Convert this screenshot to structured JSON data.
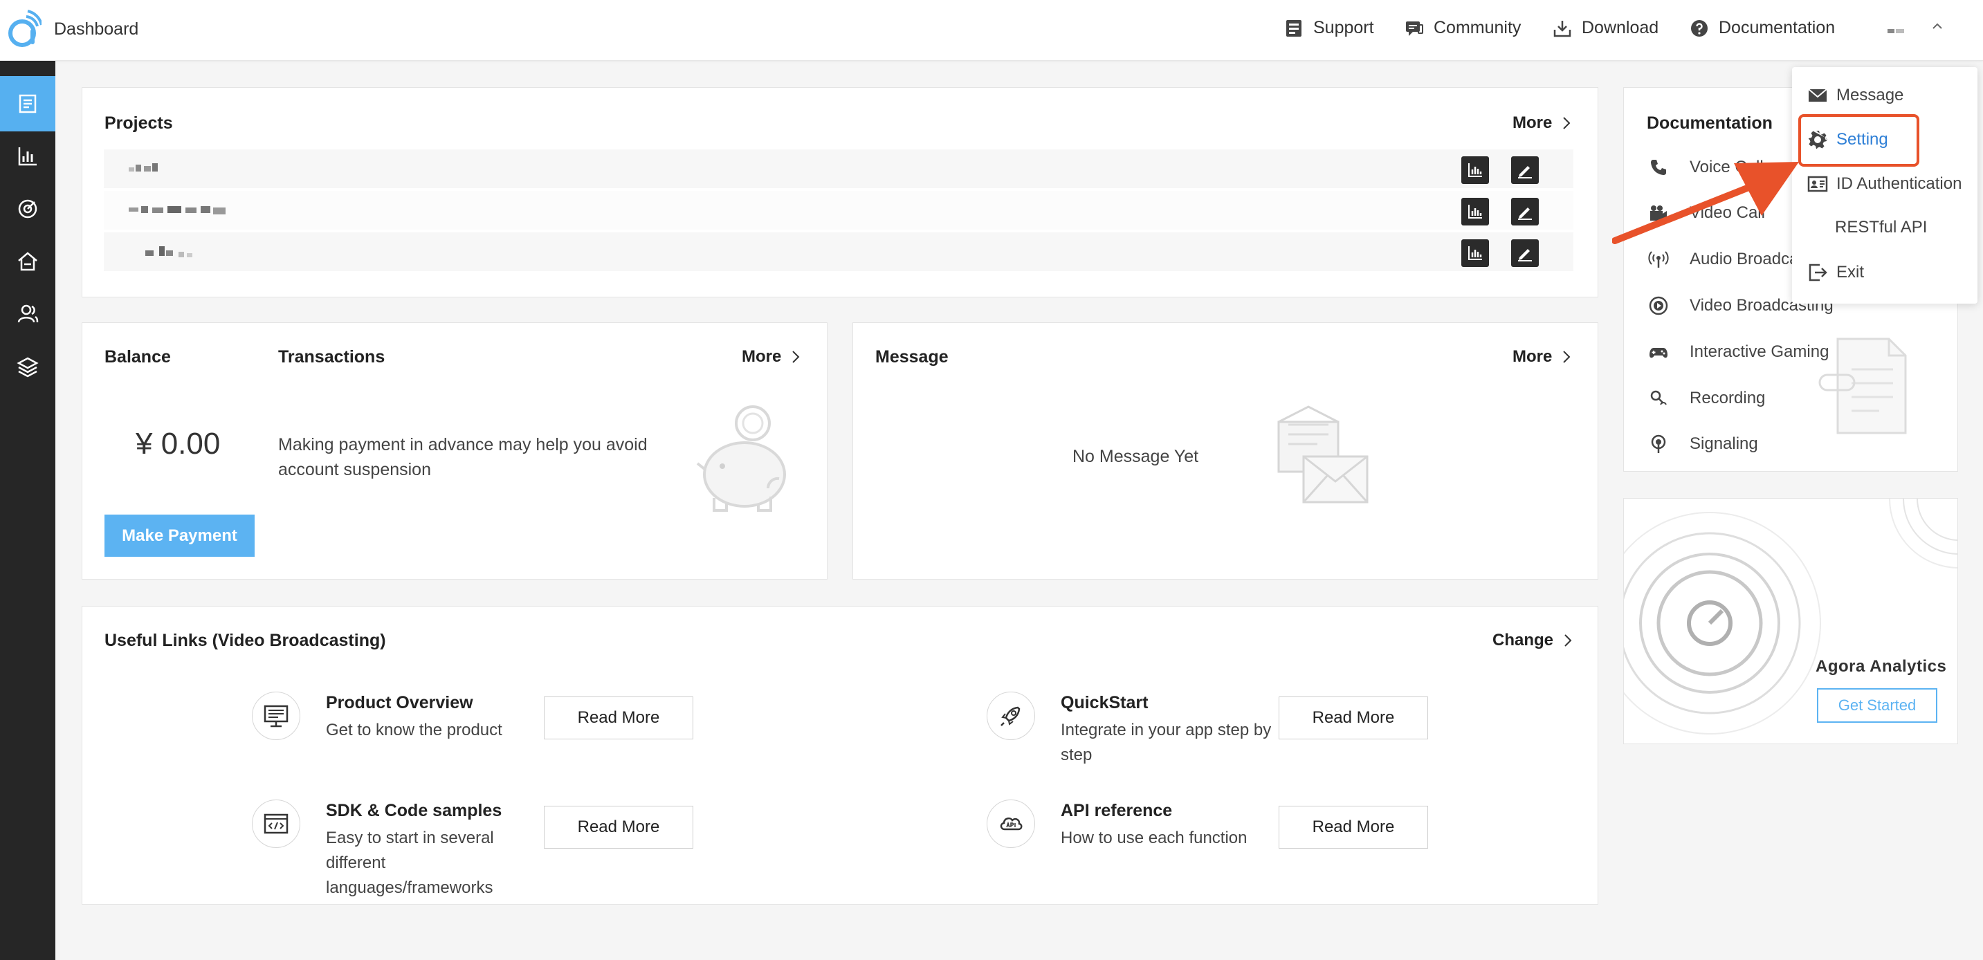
{
  "header": {
    "title": "Dashboard",
    "nav": [
      {
        "label": "Support",
        "icon": "support-icon"
      },
      {
        "label": "Community",
        "icon": "community-icon"
      },
      {
        "label": "Download",
        "icon": "download-icon"
      },
      {
        "label": "Documentation",
        "icon": "documentation-icon"
      }
    ]
  },
  "sidebar": {
    "items": [
      {
        "icon": "projects-icon",
        "active": true
      },
      {
        "icon": "analytics-icon",
        "active": false
      },
      {
        "icon": "target-icon",
        "active": false
      },
      {
        "icon": "home-icon",
        "active": false
      },
      {
        "icon": "users-icon",
        "active": false
      },
      {
        "icon": "layers-icon",
        "active": false
      }
    ]
  },
  "projects": {
    "title": "Projects",
    "more": "More"
  },
  "balance": {
    "title": "Balance",
    "amount": "¥ 0.00",
    "transactions_title": "Transactions",
    "more": "More",
    "description": "Making payment in advance may help you avoid account suspension",
    "pay_button": "Make Payment"
  },
  "message": {
    "title": "Message",
    "more": "More",
    "empty": "No Message Yet"
  },
  "useful_links": {
    "title": "Useful Links (Video Broadcasting)",
    "change": "Change",
    "read_more": "Read More",
    "items": [
      {
        "title": "Product Overview",
        "desc": "Get to know the product",
        "icon": "monitor-icon"
      },
      {
        "title": "QuickStart",
        "desc": "Integrate in your app step by step",
        "icon": "rocket-icon"
      },
      {
        "title": "SDK & Code samples",
        "desc": "Easy to start in several different languages/frameworks",
        "icon": "code-icon"
      },
      {
        "title": "API reference",
        "desc": "How to use each function",
        "icon": "api-cloud-icon"
      }
    ]
  },
  "documentation": {
    "title": "Documentation",
    "items": [
      {
        "label": "Voice Call",
        "icon": "phone-icon"
      },
      {
        "label": "Video Call",
        "icon": "video-camera-icon"
      },
      {
        "label": "Audio Broadcasting",
        "icon": "broadcast-icon"
      },
      {
        "label": "Video Broadcasting",
        "icon": "play-circle-icon"
      },
      {
        "label": "Interactive Gaming",
        "icon": "gamepad-icon"
      },
      {
        "label": "Recording",
        "icon": "recording-icon"
      },
      {
        "label": "Signaling",
        "icon": "signal-icon"
      }
    ]
  },
  "analytics": {
    "title": "Agora Analytics",
    "button": "Get Started"
  },
  "account_menu": {
    "items": [
      {
        "label": "Message",
        "icon": "mail-icon"
      },
      {
        "label": "Setting",
        "icon": "gear-icon",
        "selected": true
      },
      {
        "label": "ID Authentication",
        "icon": "id-card-icon"
      },
      {
        "label": "RESTful API",
        "icon": ""
      },
      {
        "label": "Exit",
        "icon": "exit-icon"
      }
    ]
  },
  "colors": {
    "accent": "#5cb3f2",
    "sidebar": "#262626",
    "annotation": "#e8522a",
    "selected_text": "#2e7fd6"
  }
}
